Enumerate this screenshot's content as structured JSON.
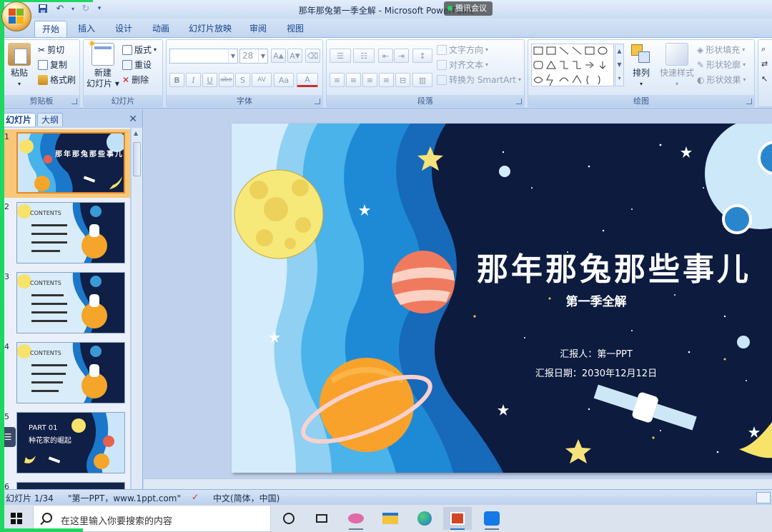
{
  "window": {
    "title": "那年那兔第一季全解 - Microsoft PowerPoint",
    "meeting_badge": "腾讯会议"
  },
  "tabs": [
    "开始",
    "插入",
    "设计",
    "动画",
    "幻灯片放映",
    "审阅",
    "视图"
  ],
  "active_tab": "开始",
  "ribbon": {
    "clipboard": {
      "paste": "粘贴",
      "cut": "剪切",
      "copy": "复制",
      "format_painter": "格式刷",
      "label": "剪贴板"
    },
    "slides": {
      "new_slide": "新建",
      "new_slide_2": "幻灯片",
      "layout": "版式",
      "reset": "重设",
      "delete": "删除",
      "label": "幻灯片"
    },
    "font": {
      "font_size": "28",
      "label": "字体",
      "bold": "B",
      "italic": "I",
      "underline": "U",
      "strike": "abe",
      "shadow": "S",
      "spacing": "AV",
      "case": "Aa",
      "color": "A"
    },
    "paragraph": {
      "text_direction": "文字方向",
      "align_text": "对齐文本",
      "smartart": "转换为 SmartArt",
      "label": "段落"
    },
    "drawing": {
      "arrange": "排列",
      "quick_styles": "快速样式",
      "shape_fill": "形状填充",
      "shape_outline": "形状轮廓",
      "shape_effects": "形状效果",
      "label": "绘图"
    }
  },
  "left_pane": {
    "tabs": [
      "幻灯片",
      "大纲"
    ],
    "active_tab": "幻灯片",
    "thumbnails": [
      {
        "num": "1",
        "title": "那年那兔那些事儿"
      },
      {
        "num": "2",
        "title": "CONTENTS"
      },
      {
        "num": "3",
        "title": "CONTENTS"
      },
      {
        "num": "4",
        "title": "CONTENTS"
      },
      {
        "num": "5",
        "title": "PART 01",
        "subtitle": "种花家的崛起"
      },
      {
        "num": "6",
        "title": ""
      }
    ]
  },
  "slide": {
    "title": "那年那兔那些事儿",
    "subtitle": "第一季全解",
    "reporter": "汇报人：第一PPT",
    "date": "汇报日期：2030年12月12日"
  },
  "statusbar": {
    "slide_info": "幻灯片 1/34",
    "theme": "\"第一PPT，www.1ppt.com\"",
    "language": "中文(简体，中国)"
  },
  "taskbar": {
    "search_placeholder": "在这里输入你要搜索的内容"
  },
  "colors": {
    "ribbon_blue": "#15428b",
    "slide_bg": "#0c1b3e",
    "accent_green": "#1ed760",
    "selection": "#f9c77a"
  }
}
